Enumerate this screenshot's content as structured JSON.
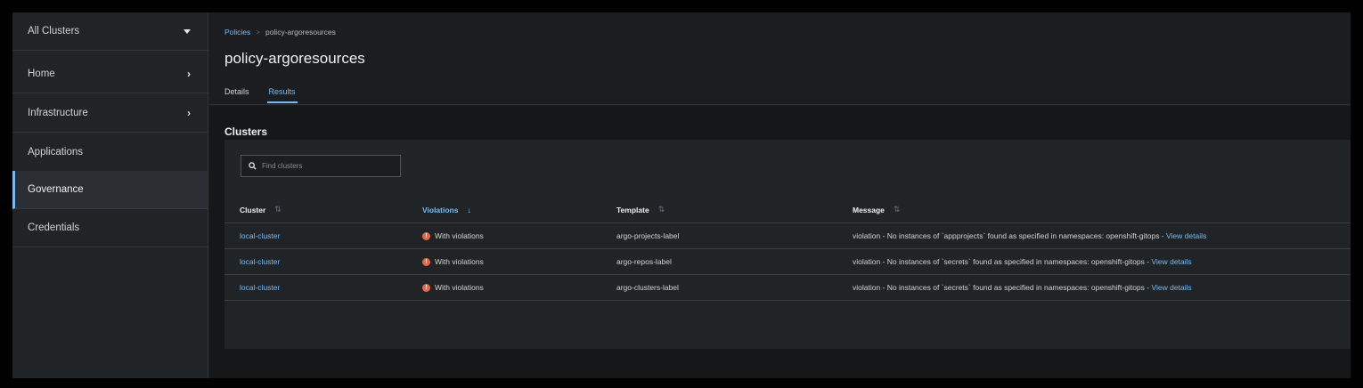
{
  "sidebar": {
    "items": [
      {
        "label": "All Clusters",
        "icon": "caret-down-icon"
      },
      {
        "label": "Home",
        "icon": "chevron-right-icon"
      },
      {
        "label": "Infrastructure",
        "icon": "chevron-right-icon"
      },
      {
        "label": "Applications",
        "icon": ""
      },
      {
        "label": "Governance",
        "icon": "",
        "active": true
      },
      {
        "label": "Credentials",
        "icon": ""
      }
    ]
  },
  "breadcrumb": {
    "parent": "Policies",
    "separator": ">",
    "current": "policy-argoresources"
  },
  "page": {
    "title": "policy-argoresources"
  },
  "tabs": [
    {
      "label": "Details",
      "active": false
    },
    {
      "label": "Results",
      "active": true
    }
  ],
  "clusters": {
    "section_title": "Clusters",
    "search_placeholder": "Find clusters",
    "columns": [
      "Cluster",
      "Violations",
      "Template",
      "Message"
    ],
    "rows": [
      {
        "cluster": "local-cluster",
        "violations": "With violations",
        "template": "argo-projects-label",
        "message": "violation - No instances of `appprojects` found as specified in namespaces: openshift-gitops -",
        "link": "View details"
      },
      {
        "cluster": "local-cluster",
        "violations": "With violations",
        "template": "argo-repos-label",
        "message": "violation - No instances of `secrets` found as specified in namespaces: openshift-gitops -",
        "link": "View details"
      },
      {
        "cluster": "local-cluster",
        "violations": "With violations",
        "template": "argo-clusters-label",
        "message": "violation - No instances of `secrets` found as specified in namespaces: openshift-gitops -",
        "link": "View details"
      }
    ]
  },
  "colors": {
    "accent": "#73bcf7",
    "violation": "#f0643c",
    "sidebar_bg": "#212427",
    "page_bg": "#151719"
  }
}
